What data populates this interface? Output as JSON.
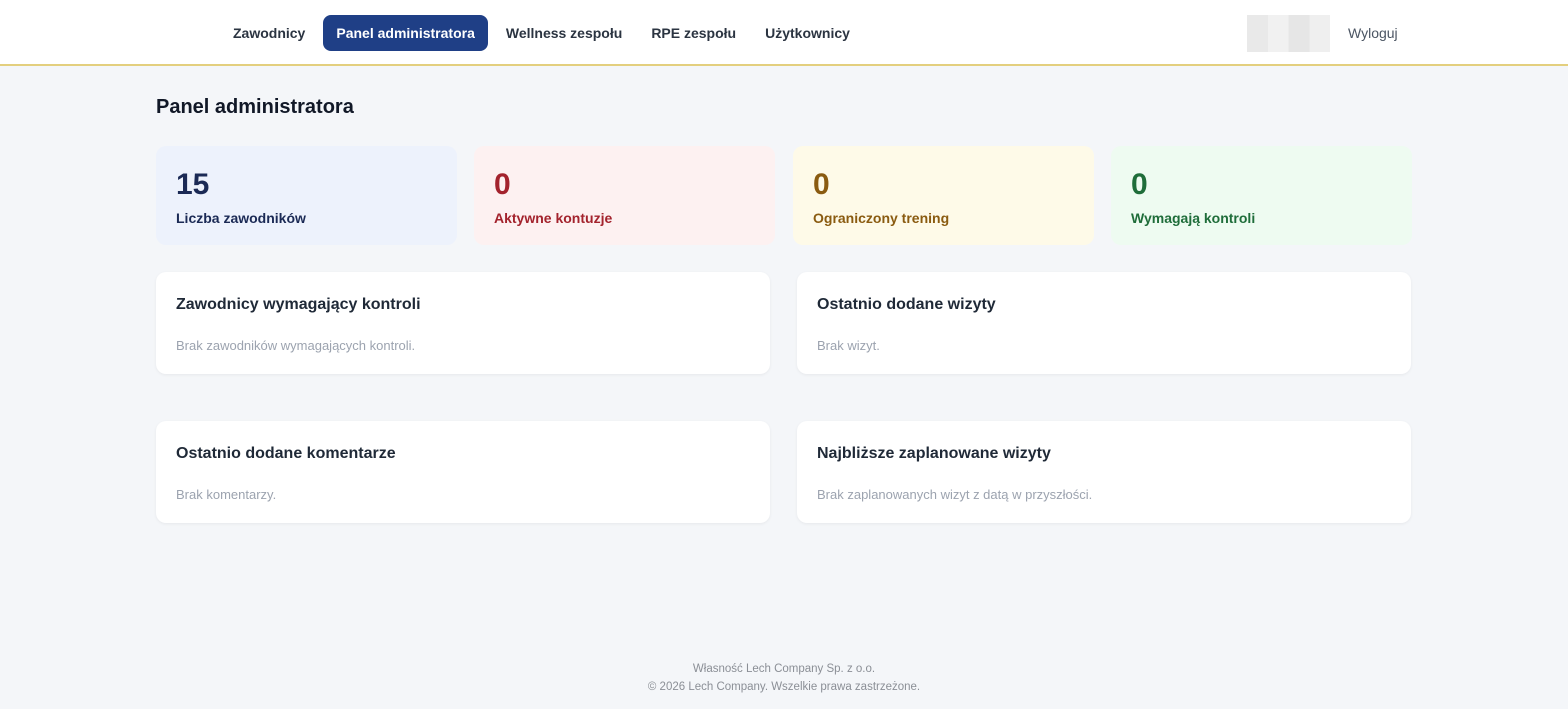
{
  "nav": {
    "items": [
      {
        "label": "Zawodnicy"
      },
      {
        "label": "Panel administratora"
      },
      {
        "label": "Wellness zespołu"
      },
      {
        "label": "RPE zespołu"
      },
      {
        "label": "Użytkownicy"
      }
    ],
    "active_index": 1,
    "logout_label": "Wyloguj"
  },
  "page": {
    "title": "Panel administratora"
  },
  "stats": [
    {
      "value": "15",
      "label": "Liczba zawodników",
      "color": "#1b2a55"
    },
    {
      "value": "0",
      "label": "Aktywne kontuzje",
      "color": "#a3232d"
    },
    {
      "value": "0",
      "label": "Ograniczony trening",
      "color": "#8a5b10"
    },
    {
      "value": "0",
      "label": "Wymagają kontroli",
      "color": "#1f6d3a"
    }
  ],
  "cards": [
    {
      "title": "Zawodnicy wymagający kontroli",
      "empty": "Brak zawodników wymagających kontroli."
    },
    {
      "title": "Ostatnio dodane wizyty",
      "empty": "Brak wizyt."
    },
    {
      "title": "Ostatnio dodane komentarze",
      "empty": "Brak komentarzy."
    },
    {
      "title": "Najbliższe zaplanowane wizyty",
      "empty": "Brak zaplanowanych wizyt z datą w przyszłości."
    }
  ],
  "footer": {
    "line1": "Własność Lech Company Sp. z o.o.",
    "line2": "© 2026 Lech Company. Wszelkie prawa zastrzeżone."
  },
  "theme": {
    "accent": "#1f3f86",
    "border_accent": "#e3cf7e"
  }
}
